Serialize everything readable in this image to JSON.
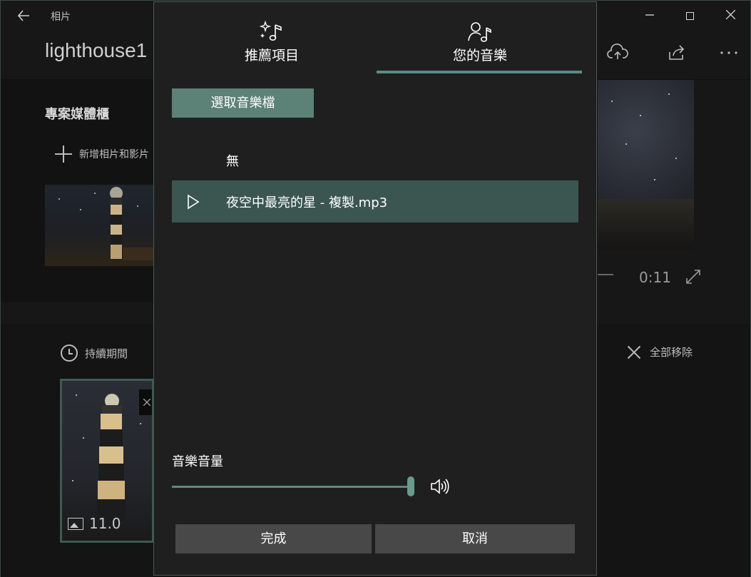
{
  "app": {
    "name": "相片",
    "project_title": "lighthouse1",
    "library_title": "專案媒體櫃",
    "add_media_label": "新增相片和影片",
    "preview_time": "0:11",
    "duration_label": "持續期間",
    "remove_all_label": "全部移除",
    "card_duration": "11.0"
  },
  "dialog": {
    "tabs": [
      {
        "label": "推薦項目",
        "icon": "sparkle-music-icon"
      },
      {
        "label": "您的音樂",
        "icon": "person-music-icon"
      }
    ],
    "active_tab": 1,
    "pick_file_label": "選取音樂檔",
    "tracks": [
      {
        "label": "無",
        "selected": false
      },
      {
        "label": "夜空中最亮的星 - 複製.mp3",
        "selected": true
      }
    ],
    "volume_label": "音樂音量",
    "volume_level": 1.0,
    "done_label": "完成",
    "cancel_label": "取消"
  },
  "colors": {
    "accent": "#5b8b7e",
    "selected_row": "#3b5650",
    "pick_button": "#5c8177",
    "dialog_bg": "#1f1f1f",
    "button_bg": "#484848"
  }
}
